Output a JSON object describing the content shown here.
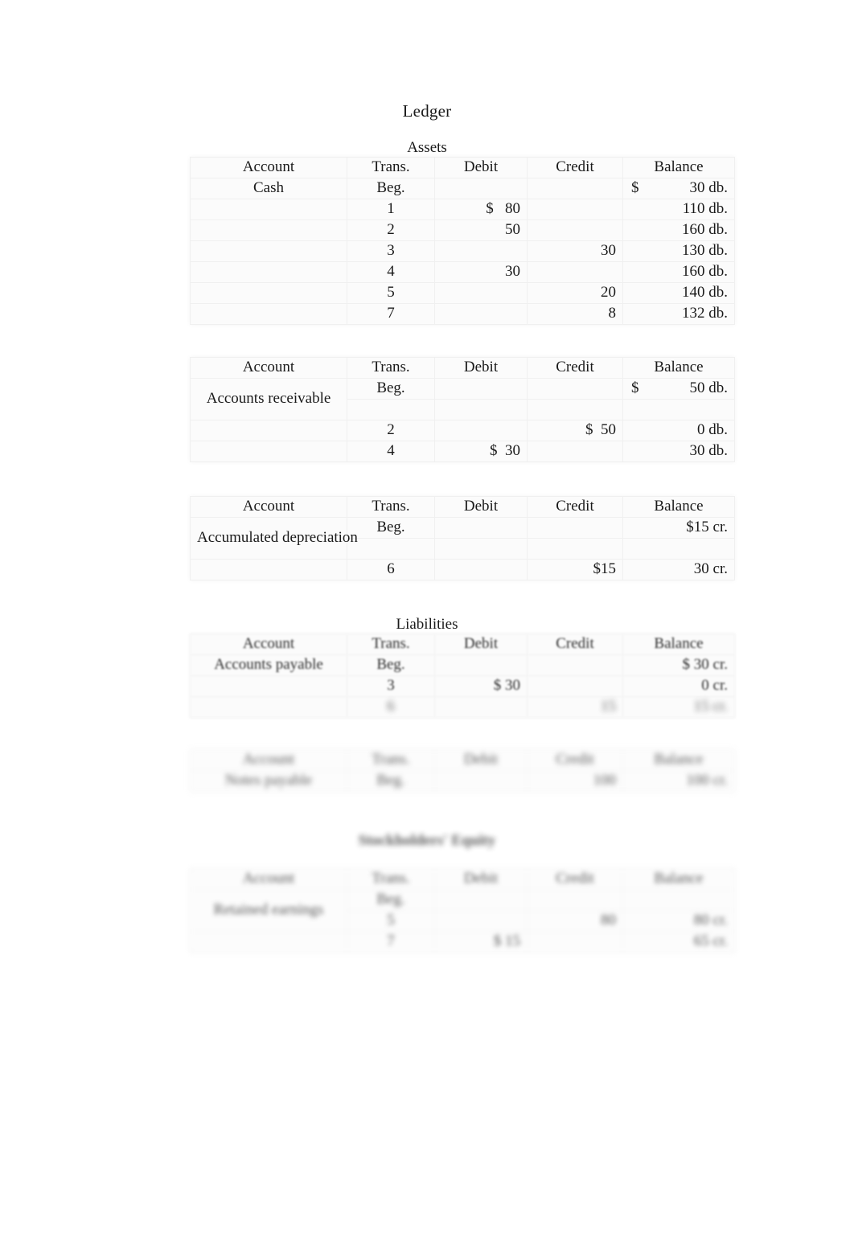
{
  "document": {
    "title": "Ledger"
  },
  "sections": {
    "assets": "Assets",
    "liabilities": "Liabilities",
    "equity": "Stockholders' Equity"
  },
  "columns": {
    "account": "Account",
    "trans": "Trans.",
    "debit": "Debit",
    "credit": "Credit",
    "balance": "Balance"
  },
  "tables": [
    {
      "id": "cash",
      "account": "Cash",
      "rows": [
        {
          "trans": "Beg.",
          "debit": "",
          "credit": "",
          "balance_symbol": "$",
          "balance": "30 db."
        },
        {
          "trans": "1",
          "debit": "$   80",
          "credit": "",
          "balance_symbol": "",
          "balance": "110 db."
        },
        {
          "trans": "2",
          "debit": "50",
          "credit": "",
          "balance_symbol": "",
          "balance": "160 db."
        },
        {
          "trans": "3",
          "debit": "",
          "credit": "30",
          "balance_symbol": "",
          "balance": "130 db."
        },
        {
          "trans": "4",
          "debit": "30",
          "credit": "",
          "balance_symbol": "",
          "balance": "160 db."
        },
        {
          "trans": "5",
          "debit": "",
          "credit": "20",
          "balance_symbol": "",
          "balance": "140 db."
        },
        {
          "trans": "7",
          "debit": "",
          "credit": "8",
          "balance_symbol": "",
          "balance": "132 db."
        }
      ]
    },
    {
      "id": "accounts-receivable",
      "account": "Accounts receivable",
      "rows": [
        {
          "trans": "Beg.",
          "debit": "",
          "credit": "",
          "balance_symbol": "$",
          "balance": "50 db."
        },
        {
          "trans": "",
          "debit": "",
          "credit": "",
          "balance_symbol": "",
          "balance": ""
        },
        {
          "trans": "2",
          "debit": "",
          "credit": "$  50",
          "balance_symbol": "",
          "balance": "0 db."
        },
        {
          "trans": "4",
          "debit": "$  30",
          "credit": "",
          "balance_symbol": "",
          "balance": "30 db."
        }
      ]
    },
    {
      "id": "accumulated-depreciation",
      "account": "Accumulated depreciation",
      "rows": [
        {
          "trans": "Beg.",
          "debit": "",
          "credit": "",
          "balance_symbol": "",
          "balance": "$15 cr."
        },
        {
          "trans": "",
          "debit": "",
          "credit": "",
          "balance_symbol": "",
          "balance": ""
        },
        {
          "trans": "6",
          "debit": "",
          "credit": "$15",
          "balance_symbol": "",
          "balance": "30 cr."
        }
      ]
    },
    {
      "id": "accounts-payable",
      "account": "Accounts payable",
      "rows": [
        {
          "trans": "Beg.",
          "debit": "",
          "credit": "",
          "balance_symbol": "",
          "balance": "$ 30 cr."
        },
        {
          "trans": "3",
          "debit": "$ 30",
          "credit": "",
          "balance_symbol": "",
          "balance": "0 cr."
        },
        {
          "trans": "6",
          "debit": "",
          "credit": "15",
          "balance_symbol": "",
          "balance": "15 cr."
        }
      ]
    },
    {
      "id": "notes-payable",
      "account": "Notes payable",
      "rows": [
        {
          "trans": "Beg.",
          "debit": "",
          "credit": "100",
          "balance_symbol": "",
          "balance": "100 cr."
        }
      ]
    },
    {
      "id": "retained-earnings",
      "account": "Retained earnings",
      "rows": [
        {
          "trans": "Beg.",
          "debit": "",
          "credit": "",
          "balance_symbol": "",
          "balance": ""
        },
        {
          "trans": "5",
          "debit": "",
          "credit": "80",
          "balance_symbol": "",
          "balance": "80 cr."
        },
        {
          "trans": "7",
          "debit": "$ 15",
          "credit": "",
          "balance_symbol": "",
          "balance": "65 cr."
        }
      ]
    }
  ]
}
